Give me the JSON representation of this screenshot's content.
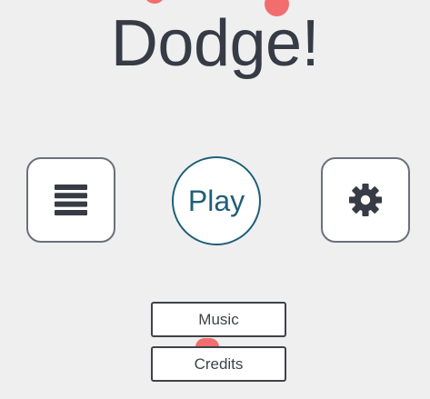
{
  "colors": {
    "background": "#efefef",
    "title_text": "#363b45",
    "icon": "#363b45",
    "play_accent": "#1f5f78",
    "small_button_text": "#3f4249",
    "obstacle": "#f26d6d"
  },
  "title": "Dodge!",
  "menu_button": {
    "icon": "hamburger-menu-icon"
  },
  "play_button": {
    "label": "Play"
  },
  "settings_button": {
    "icon": "gear-icon"
  },
  "music_button": {
    "label": "Music"
  },
  "credits_button": {
    "label": "Credits"
  }
}
